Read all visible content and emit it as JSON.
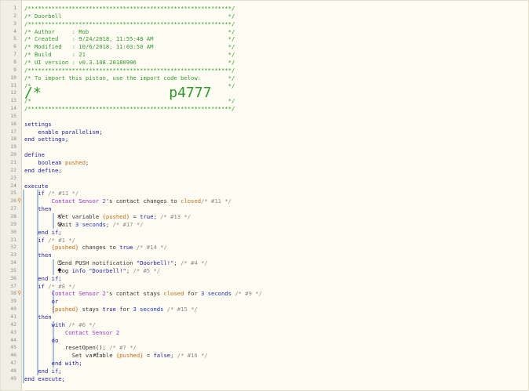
{
  "editor": {
    "lines": [
      {
        "n": "1",
        "t": "/************************************************************/",
        "cls": "c-comment"
      },
      {
        "n": "2",
        "t": "/* Doorbell                                                 */",
        "cls": "c-comment"
      },
      {
        "n": "3",
        "t": "/************************************************************/",
        "cls": "c-comment"
      },
      {
        "n": "4",
        "t": "/* Author     : Rob                                         */",
        "cls": "c-comment"
      },
      {
        "n": "5",
        "t": "/* Created    : 9/24/2018, 11:55:48 AM                      */",
        "cls": "c-comment"
      },
      {
        "n": "6",
        "t": "/* Modified   : 10/6/2018, 11:03:50 AM                      */",
        "cls": "c-comment"
      },
      {
        "n": "7",
        "t": "/* Build      : 21                                          */",
        "cls": "c-comment"
      },
      {
        "n": "8",
        "t": "/* UI version : v0.3.108.20180906                           */",
        "cls": "c-comment"
      },
      {
        "n": "9",
        "t": "/************************************************************/",
        "cls": "c-comment"
      },
      {
        "n": "10",
        "t": "/* To import this piston, use the import code below:        */",
        "cls": "c-comment"
      },
      {
        "n": "11",
        "t": "/*                                                          */",
        "cls": "c-comment"
      },
      {
        "n": "12",
        "t": "/*               p4777                                      */",
        "cls": "c-comment",
        "big": true
      },
      {
        "n": "13",
        "t": "/*                                                          */",
        "cls": "c-comment"
      },
      {
        "n": "14",
        "t": "/************************************************************/",
        "cls": "c-comment"
      },
      {
        "n": "15",
        "t": ""
      },
      {
        "n": "16",
        "segs": [
          [
            "settings",
            "c-kw"
          ]
        ]
      },
      {
        "n": "17",
        "segs": [
          [
            "    enable parallelism;",
            "c-kw"
          ]
        ]
      },
      {
        "n": "18",
        "segs": [
          [
            "end settings;",
            "c-kw"
          ]
        ]
      },
      {
        "n": "19",
        "t": ""
      },
      {
        "n": "20",
        "segs": [
          [
            "define",
            "c-kw"
          ]
        ]
      },
      {
        "n": "21",
        "segs": [
          [
            "    boolean ",
            "c-kw"
          ],
          [
            "pushed",
            "c-var"
          ],
          [
            ";",
            "c-op"
          ]
        ]
      },
      {
        "n": "22",
        "segs": [
          [
            "end define;",
            "c-kw"
          ]
        ]
      },
      {
        "n": "23",
        "t": ""
      },
      {
        "n": "24",
        "segs": [
          [
            "execute",
            "c-kw"
          ]
        ]
      },
      {
        "n": "25",
        "segs": [
          [
            "    if ",
            "c-kw"
          ],
          [
            "/* #11 */",
            "c-pid"
          ]
        ]
      },
      {
        "n": "26",
        "segs": [
          [
            "        Contact Sensor 2",
            "c-dev"
          ],
          [
            "'s contact changes to ",
            "c-op"
          ],
          [
            "closed",
            "c-var"
          ],
          [
            "/* #11 */",
            "c-pid"
          ]
        ],
        "arrow": true
      },
      {
        "n": "27",
        "segs": [
          [
            "    then",
            "c-kw"
          ]
        ]
      },
      {
        "n": "28",
        "segs": [
          [
            "        ",
            "c-op"
          ],
          [
            "  Set variable ",
            "c-op"
          ],
          [
            "{pushed}",
            "c-var"
          ],
          [
            " = ",
            "c-op"
          ],
          [
            "true",
            "c-kw"
          ],
          [
            "; ",
            "c-op"
          ],
          [
            "/* #13 */",
            "c-pid"
          ]
        ],
        "icon": "x²"
      },
      {
        "n": "29",
        "segs": [
          [
            "        ",
            "c-op"
          ],
          [
            "  Wait ",
            "c-op"
          ],
          [
            "3 seconds",
            "c-num"
          ],
          [
            "; ",
            "c-op"
          ],
          [
            "/* #17 */",
            "c-pid"
          ]
        ],
        "icon": "◷"
      },
      {
        "n": "30",
        "segs": [
          [
            "    end if;",
            "c-kw"
          ]
        ]
      },
      {
        "n": "31",
        "segs": [
          [
            "    if ",
            "c-kw"
          ],
          [
            "/* #1 */",
            "c-pid"
          ]
        ]
      },
      {
        "n": "32",
        "segs": [
          [
            "        {pushed}",
            "c-var"
          ],
          [
            " changes to ",
            "c-op"
          ],
          [
            "true",
            "c-kw"
          ],
          [
            " ",
            "c-op"
          ],
          [
            "/* #14 */",
            "c-pid"
          ]
        ]
      },
      {
        "n": "33",
        "segs": [
          [
            "    then",
            "c-kw"
          ]
        ]
      },
      {
        "n": "34",
        "segs": [
          [
            "        ",
            "c-op"
          ],
          [
            "  Send PUSH notification ",
            "c-op"
          ],
          [
            "\"Doorbell!\"",
            "c-str"
          ],
          [
            "; ",
            "c-op"
          ],
          [
            "/* #4 */",
            "c-pid"
          ]
        ],
        "icon": "▢"
      },
      {
        "n": "35",
        "segs": [
          [
            "        ",
            "c-op"
          ],
          [
            "  Log ",
            "c-op"
          ],
          [
            "info",
            "c-kw"
          ],
          [
            " ",
            "c-op"
          ],
          [
            "\"Doorbell!\"",
            "c-str"
          ],
          [
            "; ",
            "c-op"
          ],
          [
            "/* #5 */",
            "c-pid"
          ]
        ],
        "icon": "✱"
      },
      {
        "n": "36",
        "segs": [
          [
            "    end if;",
            "c-kw"
          ]
        ]
      },
      {
        "n": "37",
        "segs": [
          [
            "    if ",
            "c-kw"
          ],
          [
            "/* #8 */",
            "c-pid"
          ]
        ]
      },
      {
        "n": "38",
        "segs": [
          [
            "        Contact Sensor 2",
            "c-dev"
          ],
          [
            "'s contact stays ",
            "c-op"
          ],
          [
            "closed",
            "c-var"
          ],
          [
            " for ",
            "c-op"
          ],
          [
            "3 seconds",
            "c-num"
          ],
          [
            " ",
            "c-op"
          ],
          [
            "/* #9 */",
            "c-pid"
          ]
        ],
        "arrow": true
      },
      {
        "n": "39",
        "segs": [
          [
            "        or",
            "c-kw"
          ]
        ]
      },
      {
        "n": "40",
        "segs": [
          [
            "        {pushed}",
            "c-var"
          ],
          [
            " stays ",
            "c-op"
          ],
          [
            "true",
            "c-kw"
          ],
          [
            " for ",
            "c-op"
          ],
          [
            "3 seconds",
            "c-num"
          ],
          [
            " ",
            "c-op"
          ],
          [
            "/* #15 */",
            "c-pid"
          ]
        ]
      },
      {
        "n": "41",
        "segs": [
          [
            "    then",
            "c-kw"
          ]
        ]
      },
      {
        "n": "42",
        "segs": [
          [
            "        with ",
            "c-kw"
          ],
          [
            "/* #6 */",
            "c-pid"
          ]
        ]
      },
      {
        "n": "43",
        "segs": [
          [
            "            Contact Sensor 2",
            "c-dev"
          ]
        ]
      },
      {
        "n": "44",
        "segs": [
          [
            "        do",
            "c-kw"
          ]
        ]
      },
      {
        "n": "45",
        "segs": [
          [
            "            resetOpen(); ",
            "c-op"
          ],
          [
            "/* #7 */",
            "c-pid"
          ]
        ]
      },
      {
        "n": "46",
        "segs": [
          [
            "            ",
            "c-op"
          ],
          [
            "  Set variable ",
            "c-op"
          ],
          [
            "{pushed}",
            "c-var"
          ],
          [
            " = ",
            "c-op"
          ],
          [
            "false",
            "c-kw"
          ],
          [
            "; ",
            "c-op"
          ],
          [
            "/* #16 */",
            "c-pid"
          ]
        ],
        "icon": "x²",
        "iconIndent": true
      },
      {
        "n": "47",
        "segs": [
          [
            "        end with;",
            "c-kw"
          ]
        ]
      },
      {
        "n": "48",
        "segs": [
          [
            "    end if;",
            "c-kw"
          ]
        ]
      },
      {
        "n": "49",
        "segs": [
          [
            "end execute;",
            "c-kw"
          ]
        ]
      }
    ]
  }
}
